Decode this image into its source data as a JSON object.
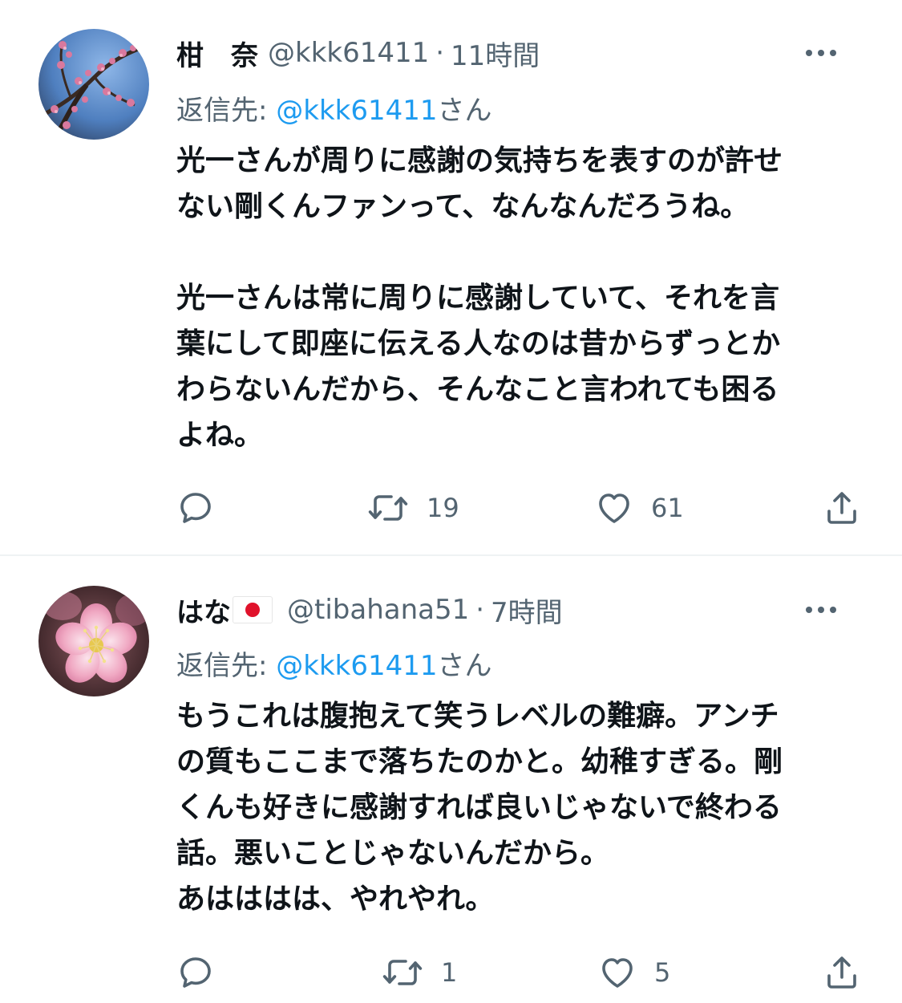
{
  "tweets": [
    {
      "display_name": "柑　奈",
      "handle": "@kkk61411",
      "separator": "·",
      "time": "11時間",
      "reply_prefix": "返信先: ",
      "reply_mention": "@kkk61411",
      "reply_suffix": "さん",
      "paragraphs": [
        [
          "光一さんが周りに感謝の気持ちを表すのが許せ",
          "ない剛くんファンって、なんなんだろうね。"
        ],
        [
          "光一さんは常に周りに感謝していて、それを言",
          "葉にして即座に伝える人なのは昔からずっとか",
          "わらないんだから、そんなこと言われても困る",
          "よね。"
        ]
      ],
      "retweet_count": "19",
      "like_count": "61",
      "avatar_icon": "plum-blossom-branch-avatar"
    },
    {
      "display_name": "はな",
      "flag_icon": "japan-flag-icon",
      "handle": "@tibahana51",
      "separator": "·",
      "time": "7時間",
      "reply_prefix": "返信先: ",
      "reply_mention": "@kkk61411",
      "reply_suffix": "さん",
      "paragraphs": [
        [
          "もうこれは腹抱えて笑うレベルの難癖。アンチ",
          "の質もここまで落ちたのかと。幼稚すぎる。剛",
          "くんも好きに感謝すれば良いじゃないで終わる",
          "話。悪いことじゃないんだから。",
          "あはははは、やれやれ。"
        ]
      ],
      "retweet_count": "1",
      "like_count": "5",
      "avatar_icon": "pink-plum-flower-avatar"
    }
  ],
  "colors": {
    "text": "#0f1419",
    "secondary": "#536471",
    "link": "#1d9bf0",
    "divider": "#eff3f4"
  }
}
